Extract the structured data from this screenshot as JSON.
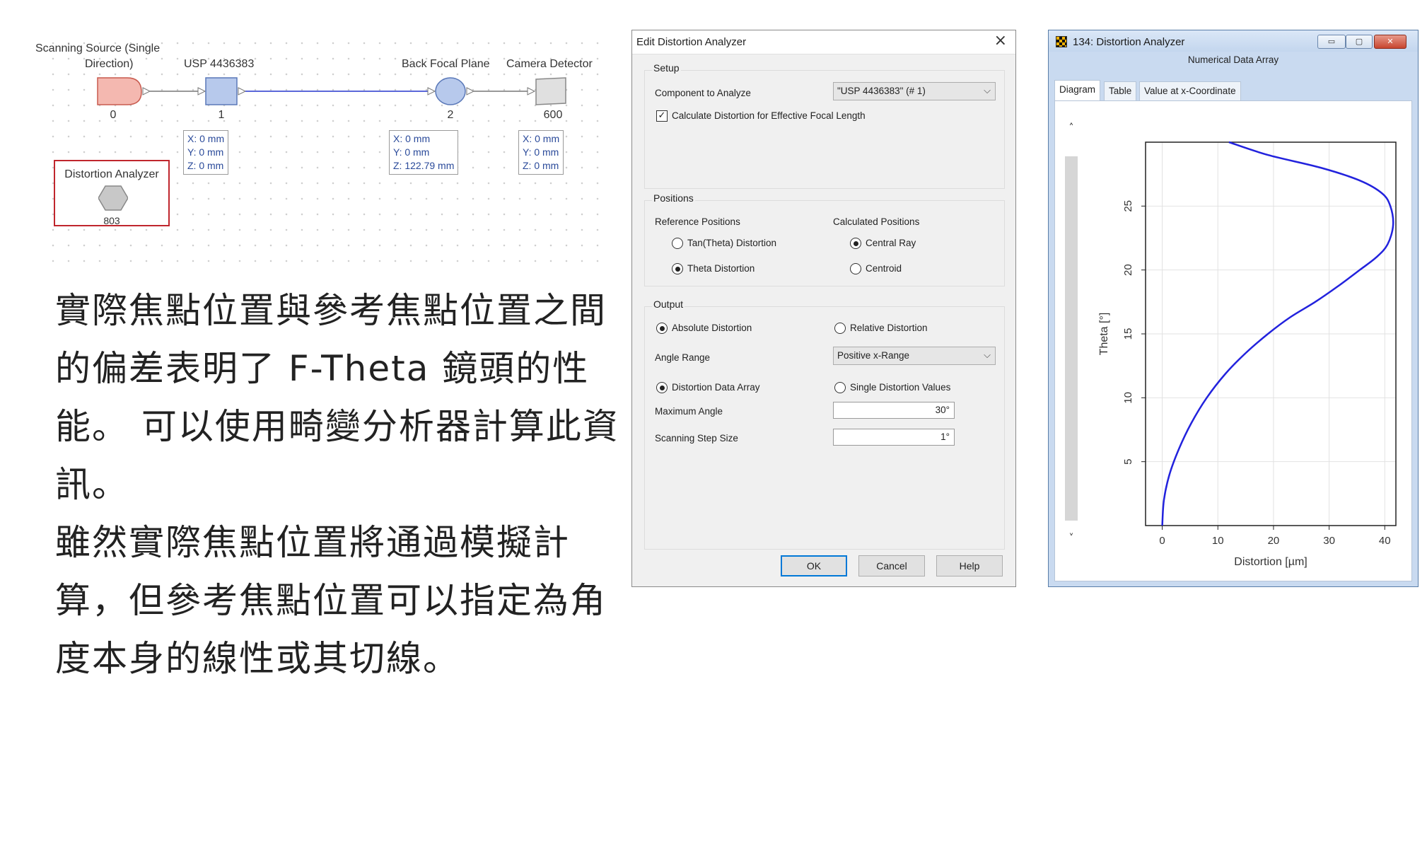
{
  "diagram": {
    "components": [
      {
        "name": "Scanning Source (Single Direction)",
        "label_line1": "Scanning Source (Single",
        "label_line2": "Direction)",
        "index": "0"
      },
      {
        "name": "USP 4436383",
        "index": "1",
        "coords": [
          "X: 0 mm",
          "Y: 0 mm",
          "Z: 0 mm"
        ]
      },
      {
        "name": "Back Focal Plane",
        "index": "2",
        "coords": [
          "X: 0 mm",
          "Y: 0 mm",
          "Z: 122.79 mm"
        ]
      },
      {
        "name": "Camera Detector",
        "index": "600",
        "coords": [
          "X: 0 mm",
          "Y: 0 mm",
          "Z: 0 mm"
        ]
      }
    ],
    "analyzer": {
      "name": "Distortion Analyzer",
      "index": "803"
    },
    "colors": {
      "source": "#f4b8b0",
      "lens": "#b7c9ec",
      "link": "#5b68d9",
      "highlight": "#c0262d"
    }
  },
  "paragraph": [
    "實際焦點位置與參考焦點位置之間的偏差表明了 F-Theta 鏡頭的性能。 可以使用畸變分析器計算此資訊。",
    "雖然實際焦點位置將通過模擬計算，但參考焦點位置可以指定為角度本身的線性或其切線。"
  ],
  "dialog": {
    "title": "Edit Distortion Analyzer",
    "close_icon": "×",
    "setup": {
      "label": "Setup",
      "component_label": "Component to Analyze",
      "component_value": "\"USP 4436383\" (# 1)",
      "calc_focal_label": "Calculate Distortion for Effective Focal Length",
      "calc_focal_checked": "✓"
    },
    "positions": {
      "label": "Positions",
      "reference_label": "Reference Positions",
      "calculated_label": "Calculated Positions",
      "tan_theta": "Tan(Theta) Distortion",
      "theta": "Theta Distortion",
      "central_ray": "Central Ray",
      "centroid": "Centroid"
    },
    "output": {
      "label": "Output",
      "absolute": "Absolute Distortion",
      "relative": "Relative Distortion",
      "angle_range_label": "Angle Range",
      "angle_range_value": "Positive x-Range",
      "data_array": "Distortion Data Array",
      "single_values": "Single Distortion Values",
      "max_angle_label": "Maximum Angle",
      "max_angle_value": "30°",
      "step_label": "Scanning Step Size",
      "step_value": "1°"
    },
    "buttons": {
      "ok": "OK",
      "cancel": "Cancel",
      "help": "Help"
    }
  },
  "window": {
    "title": "134: Distortion Analyzer",
    "subtitle": "Numerical Data Array",
    "tabs": [
      "Diagram",
      "Table",
      "Value at x-Coordinate"
    ],
    "buttons": {
      "min": "▭",
      "max": "▢",
      "close": "✕"
    }
  },
  "chart_data": {
    "type": "line",
    "xlabel": "Distortion [µm]",
    "ylabel": "Theta [°]",
    "xlim": [
      -3,
      42
    ],
    "ylim": [
      0,
      30
    ],
    "xticks": [
      0,
      10,
      20,
      30,
      40
    ],
    "yticks": [
      5,
      10,
      15,
      20,
      25
    ],
    "color": "#2222dd",
    "series": [
      {
        "x": [
          0,
          0.3,
          1.3,
          3.0,
          5.2,
          8.0,
          11.4,
          15.0,
          19.0,
          23.0,
          27.5,
          31.5,
          35.5,
          38.5,
          40.5,
          41.5,
          41.0,
          39.5,
          35.5,
          28.5,
          19.0,
          12.0
        ],
        "y": [
          0,
          2,
          4,
          6,
          8,
          10,
          11.9,
          13.5,
          15,
          16.3,
          17.5,
          18.7,
          20,
          21,
          22,
          23.5,
          25,
          26,
          27,
          28,
          29,
          30
        ]
      }
    ]
  }
}
